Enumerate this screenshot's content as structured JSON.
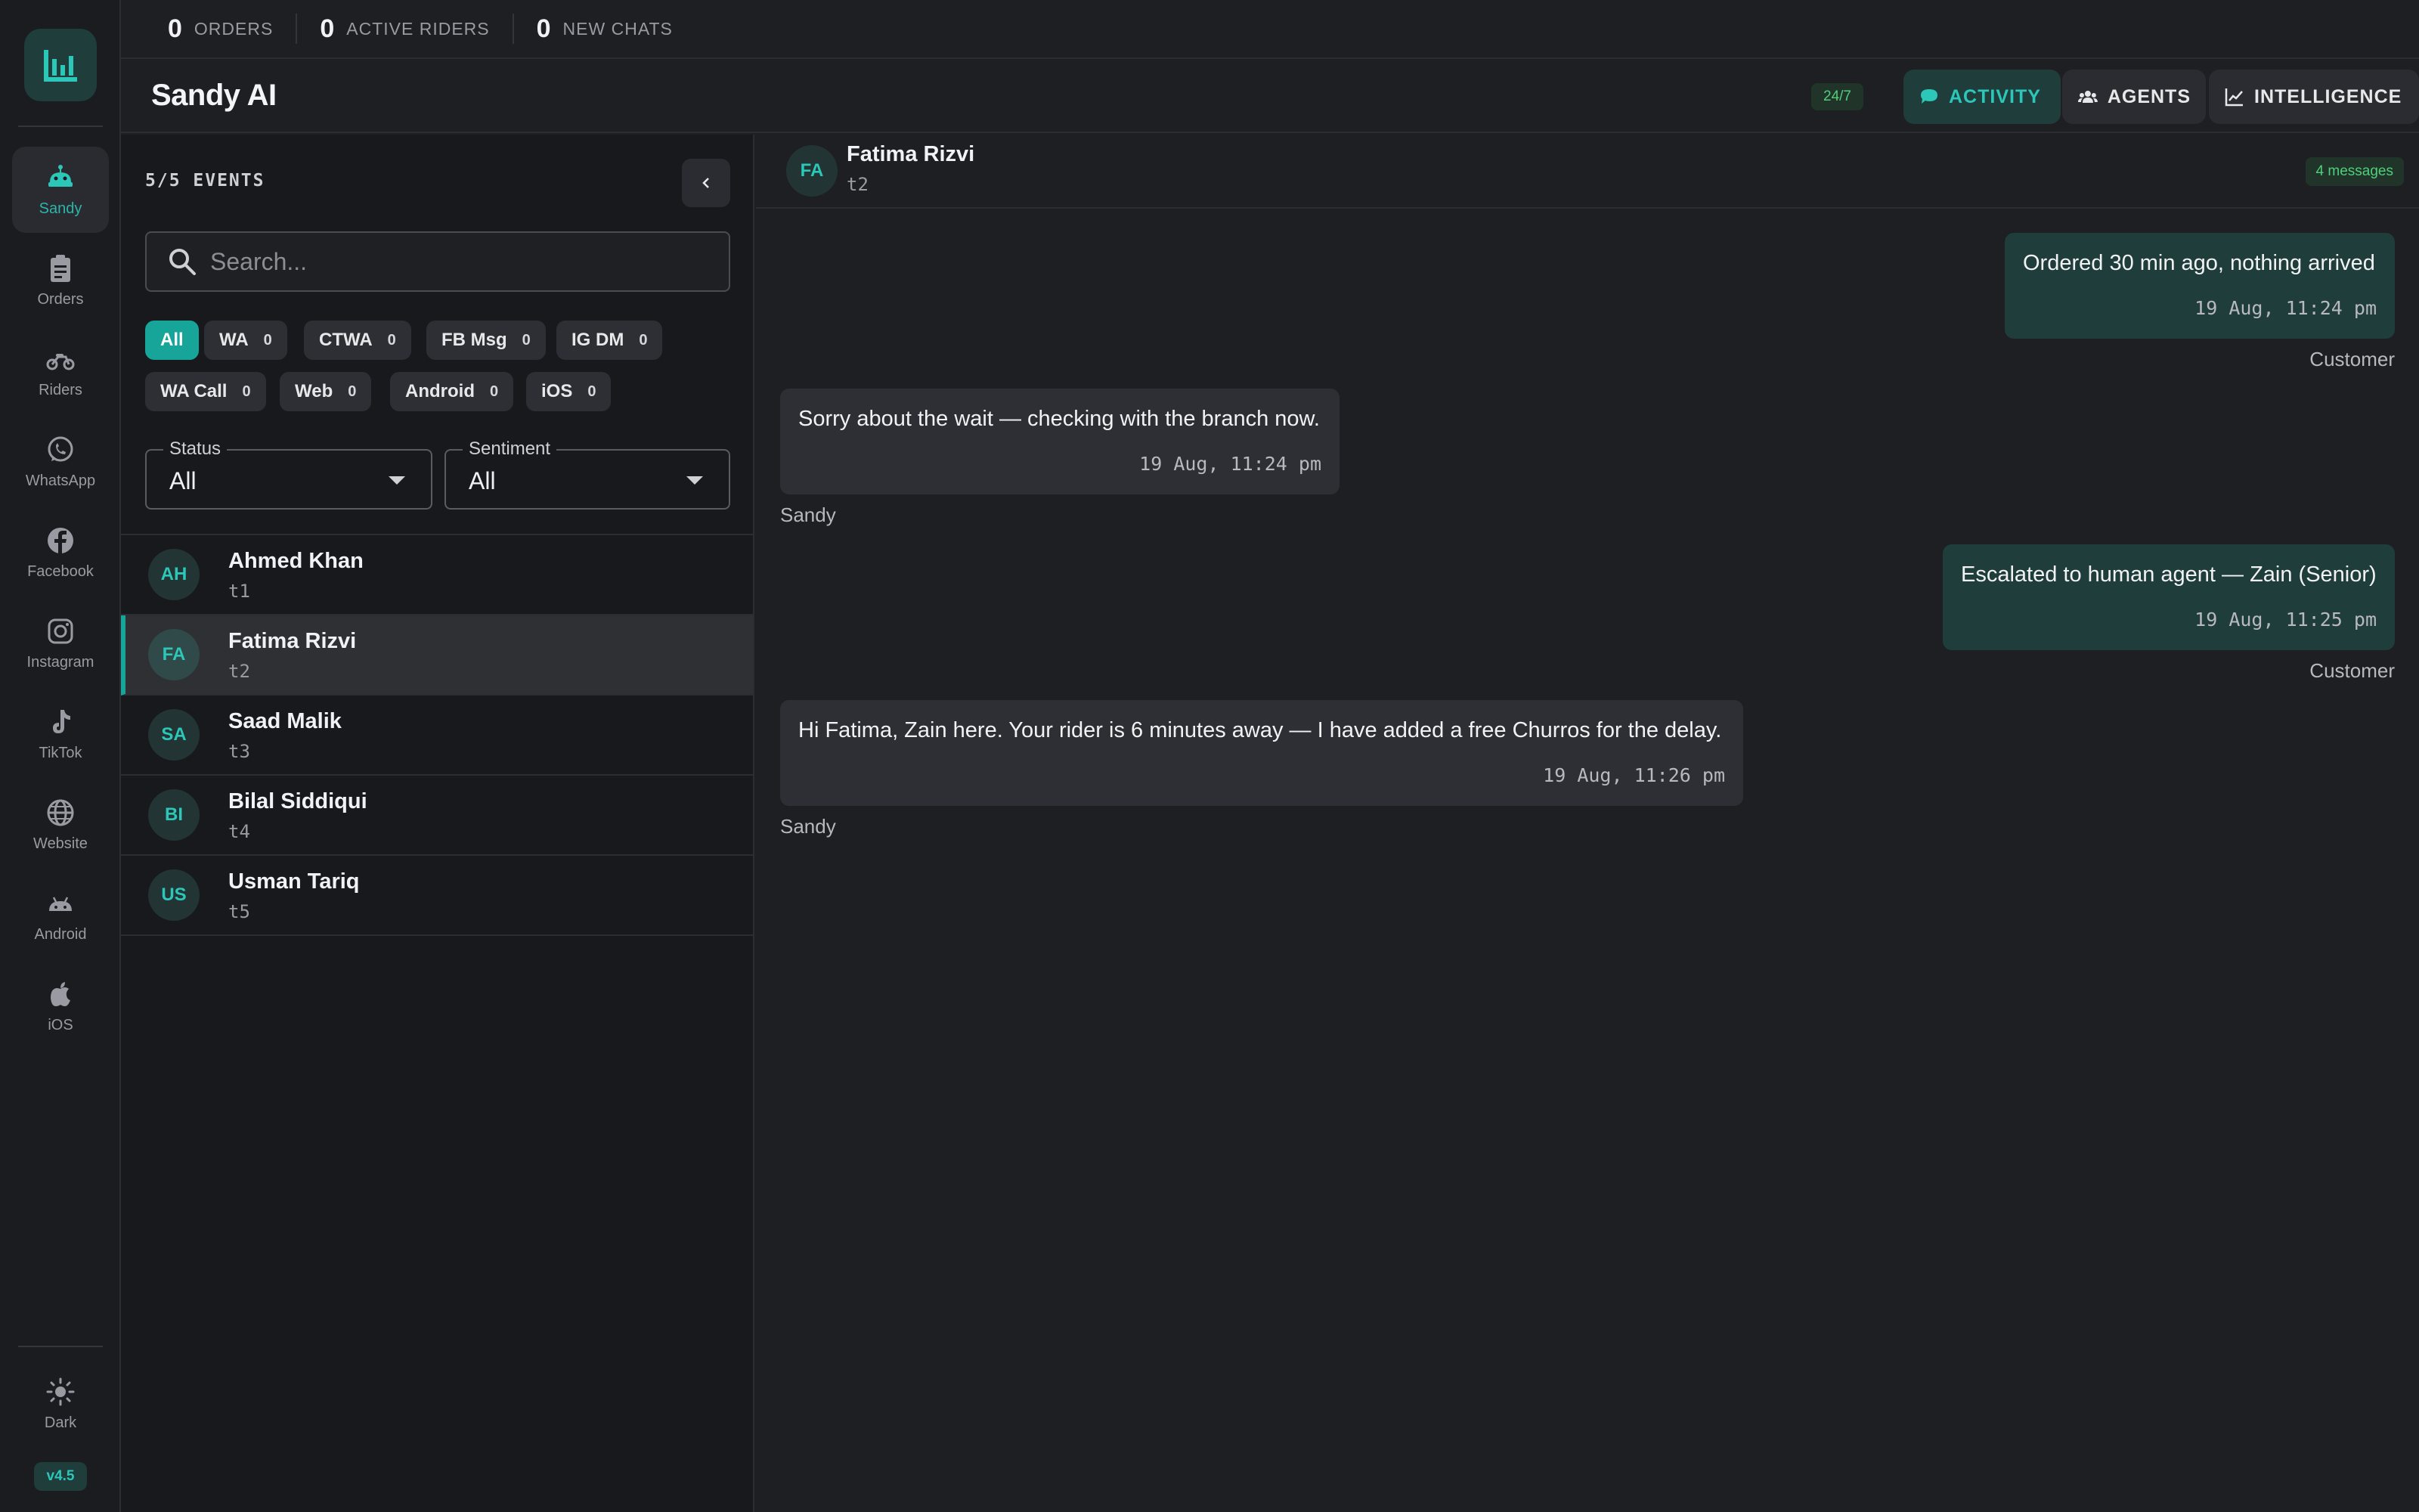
{
  "stats": [
    {
      "value": "0",
      "label": "ORDERS"
    },
    {
      "value": "0",
      "label": "ACTIVE RIDERS"
    },
    {
      "value": "0",
      "label": "NEW CHATS"
    }
  ],
  "header": {
    "title": "Sandy AI",
    "badge": "24/7",
    "tabs": [
      {
        "label": "ACTIVITY",
        "icon": "chat-bubble-icon",
        "active": true
      },
      {
        "label": "AGENTS",
        "icon": "users-icon",
        "active": false
      },
      {
        "label": "INTELLIGENCE",
        "icon": "trend-chart-icon",
        "active": false
      }
    ]
  },
  "rail": {
    "items": [
      {
        "label": "Sandy",
        "icon": "robot-icon",
        "active": true
      },
      {
        "label": "Orders",
        "icon": "clipboard-icon"
      },
      {
        "label": "Riders",
        "icon": "motorbike-icon"
      },
      {
        "label": "WhatsApp",
        "icon": "whatsapp-icon"
      },
      {
        "label": "Facebook",
        "icon": "facebook-icon"
      },
      {
        "label": "Instagram",
        "icon": "instagram-icon"
      },
      {
        "label": "TikTok",
        "icon": "tiktok-icon"
      },
      {
        "label": "Website",
        "icon": "globe-icon"
      },
      {
        "label": "Android",
        "icon": "android-icon"
      },
      {
        "label": "iOS",
        "icon": "apple-icon"
      }
    ],
    "theme_label": "Dark",
    "version": "v4.5"
  },
  "events": {
    "count_label": "5/5 EVENTS",
    "search_placeholder": "Search...",
    "chips": [
      {
        "label": "All",
        "active": true
      },
      {
        "label": "WA",
        "count": "0"
      },
      {
        "label": "CTWA",
        "count": "0"
      },
      {
        "label": "FB Msg",
        "count": "0"
      },
      {
        "label": "IG DM",
        "count": "0"
      },
      {
        "label": "WA Call",
        "count": "0"
      },
      {
        "label": "Web",
        "count": "0"
      },
      {
        "label": "Android",
        "count": "0"
      },
      {
        "label": "iOS",
        "count": "0"
      }
    ],
    "status": {
      "label": "Status",
      "value": "All"
    },
    "sentiment": {
      "label": "Sentiment",
      "value": "All"
    },
    "list": [
      {
        "initials": "AH",
        "name": "Ahmed Khan",
        "sub": "t1"
      },
      {
        "initials": "FA",
        "name": "Fatima Rizvi",
        "sub": "t2",
        "active": true
      },
      {
        "initials": "SA",
        "name": "Saad Malik",
        "sub": "t3"
      },
      {
        "initials": "BI",
        "name": "Bilal Siddiqui",
        "sub": "t4"
      },
      {
        "initials": "US",
        "name": "Usman Tariq",
        "sub": "t5"
      }
    ]
  },
  "chat": {
    "initials": "FA",
    "name": "Fatima Rizvi",
    "sub": "t2",
    "count_badge": "4 messages",
    "messages": [
      {
        "text": "Ordered 30 min ago, nothing arrived",
        "time": "19 Aug, 11:24 pm",
        "sender": "Customer",
        "dir": "out"
      },
      {
        "text": "Sorry about the wait — checking with the branch now.",
        "time": "19 Aug, 11:24 pm",
        "sender": "Sandy",
        "dir": "in"
      },
      {
        "text": "Escalated to human agent — Zain (Senior)",
        "time": "19 Aug, 11:25 pm",
        "sender": "Customer",
        "dir": "out"
      },
      {
        "text": "Hi Fatima, Zain here. Your rider is 6 minutes away — I have added a free Churros for the delay.",
        "time": "19 Aug, 11:26 pm",
        "sender": "Sandy",
        "dir": "in"
      }
    ]
  },
  "colors": {
    "accent": "#17a59a",
    "accent_text": "#2cc7b8",
    "bg": "#1e1f23",
    "panel": "#18191d"
  }
}
